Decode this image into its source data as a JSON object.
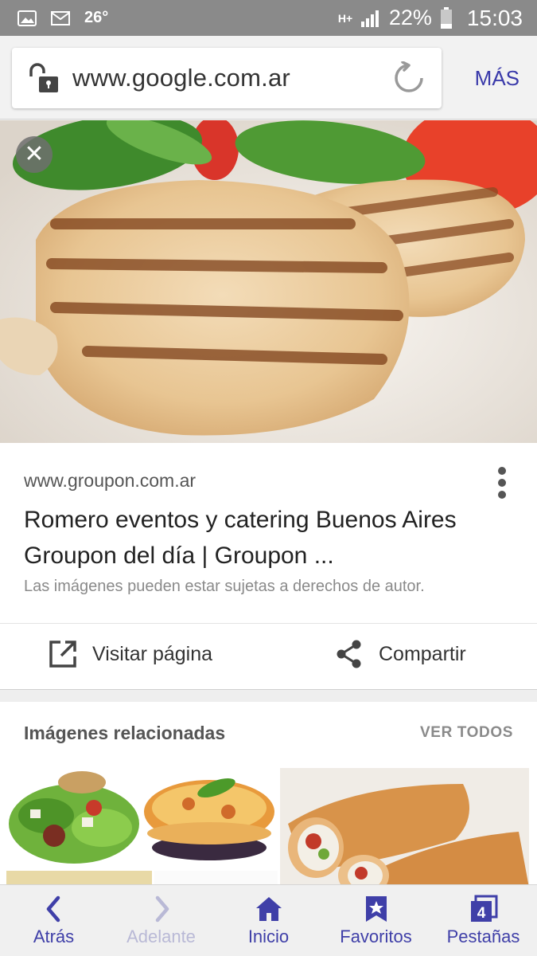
{
  "status_bar": {
    "temperature": "26°",
    "network": "H+",
    "battery": "22%",
    "time": "15:03",
    "icons": [
      "gallery-icon",
      "mail-icon",
      "signal-icon",
      "battery-icon"
    ]
  },
  "browser": {
    "url": "www.google.com.ar",
    "more_label": "MÁS",
    "icons": [
      "lock-icon",
      "reload-icon"
    ]
  },
  "hero": {
    "close_icon": "close-icon"
  },
  "result": {
    "site": "www.groupon.com.ar",
    "title": "Romero eventos y catering Buenos Aires Groupon del día | Groupon ...",
    "copyright_notice": "Las imágenes pueden estar sujetas a derechos de autor.",
    "visit_label": "Visitar página",
    "share_label": "Compartir"
  },
  "related": {
    "title": "Imágenes relacionadas",
    "see_all_label": "VER TODOS"
  },
  "bottom_nav": {
    "items": [
      {
        "label": "Atrás",
        "icon": "back-icon"
      },
      {
        "label": "Adelante",
        "icon": "forward-icon"
      },
      {
        "label": "Inicio",
        "icon": "home-icon"
      },
      {
        "label": "Favoritos",
        "icon": "bookmark-icon"
      },
      {
        "label": "Pestañas",
        "icon": "tabs-icon",
        "count": "4"
      }
    ]
  },
  "colors": {
    "accent": "#3f3fa8",
    "status_bar": "#8a8a8a"
  }
}
